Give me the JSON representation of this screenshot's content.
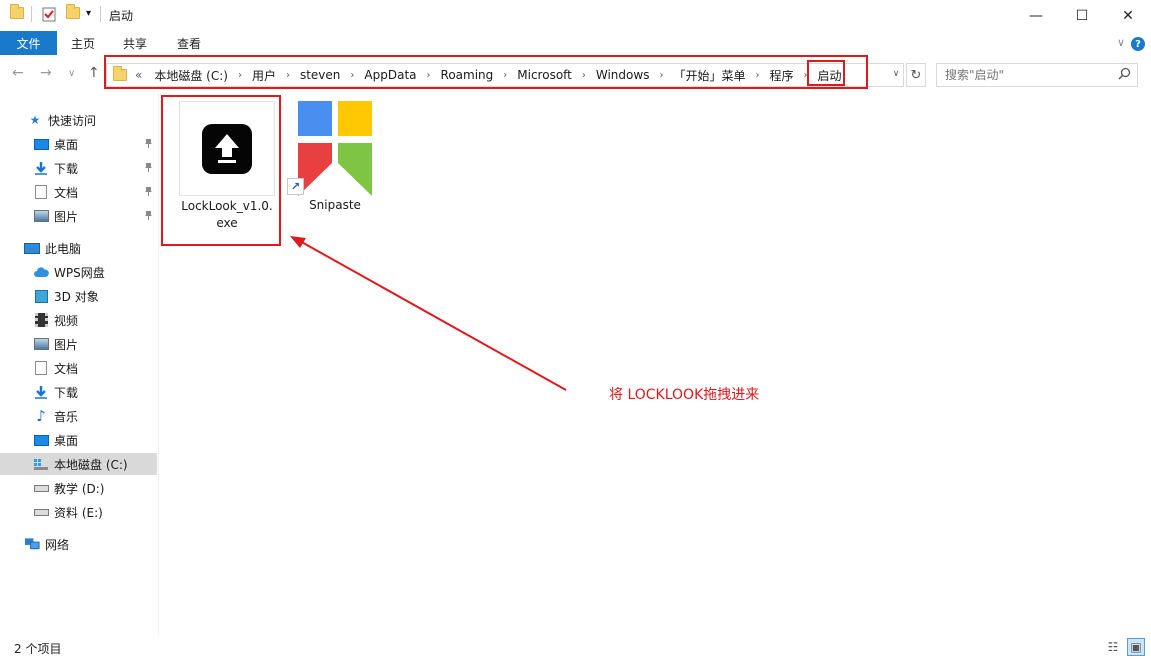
{
  "window": {
    "title": "启动",
    "minimize_glyph": "—",
    "maximize_glyph": "☐",
    "close_glyph": "✕",
    "dropdown_glyph": "▾"
  },
  "ribbon": {
    "file_tab": "文件",
    "tabs": [
      "主页",
      "共享",
      "查看"
    ],
    "collapse_glyph": "∨",
    "help_glyph": "?"
  },
  "nav": {
    "back_glyph": "←",
    "forward_glyph": "→",
    "recent_glyph": "∨",
    "up_glyph": "↑",
    "overflow_glyph": "«",
    "breadcrumbs": [
      "本地磁盘 (C:)",
      "用户",
      "steven",
      "AppData",
      "Roaming",
      "Microsoft",
      "Windows",
      "「开始」菜单",
      "程序",
      "启动"
    ],
    "separator": "›",
    "dropdown_glyph": "∨",
    "refresh_glyph": "↻",
    "search_placeholder": "搜索\"启动\"",
    "search_glyph": "⚲"
  },
  "sidebar": {
    "quick_access": {
      "label": "快速访问",
      "items": [
        {
          "label": "桌面",
          "icon": "desktop-icon"
        },
        {
          "label": "下载",
          "icon": "download-icon"
        },
        {
          "label": "文档",
          "icon": "document-icon"
        },
        {
          "label": "图片",
          "icon": "pictures-icon"
        }
      ],
      "pin_glyph": "📌"
    },
    "this_pc": {
      "label": "此电脑",
      "items": [
        {
          "label": "WPS网盘",
          "icon": "wps-cloud-icon"
        },
        {
          "label": "3D 对象",
          "icon": "3d-objects-icon"
        },
        {
          "label": "视频",
          "icon": "video-icon"
        },
        {
          "label": "图片",
          "icon": "pictures-icon"
        },
        {
          "label": "文档",
          "icon": "document-icon"
        },
        {
          "label": "下载",
          "icon": "download-icon"
        },
        {
          "label": "音乐",
          "icon": "music-icon"
        },
        {
          "label": "桌面",
          "icon": "desktop-icon"
        },
        {
          "label": "本地磁盘 (C:)",
          "icon": "drive-c-icon",
          "selected": true
        },
        {
          "label": "教学 (D:)",
          "icon": "drive-icon"
        },
        {
          "label": "资料 (E:)",
          "icon": "drive-icon"
        }
      ]
    },
    "network": {
      "label": "网络"
    }
  },
  "content": {
    "files": [
      {
        "name": "LockLook_v1.0.exe",
        "name_line1": "LockLook_v1.0.",
        "name_line2": "exe",
        "icon": "upload-app-icon",
        "selected": true
      },
      {
        "name": "Snipaste",
        "icon": "snipaste-icon",
        "shortcut": true,
        "shortcut_glyph": "↗"
      }
    ],
    "annotation": "将 LOCKLOOK拖拽进来",
    "annotation_color": "#e0191c"
  },
  "status": {
    "item_count": "2 个项目",
    "details_view_glyph": "☷",
    "large_icons_view_glyph": "▣"
  },
  "colors": {
    "accent": "#1979ca",
    "highlight_red": "#e0191c",
    "snipaste_blue": "#4a8ff0",
    "snipaste_yellow": "#ffc800",
    "snipaste_red": "#e84040",
    "snipaste_green": "#7ec544"
  }
}
